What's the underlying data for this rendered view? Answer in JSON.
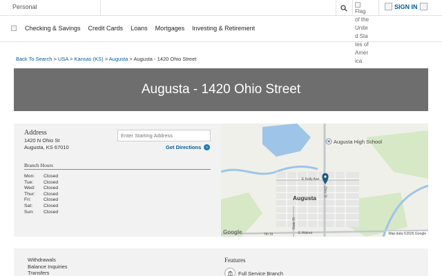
{
  "topbar": {
    "segment": "Personal",
    "flag_alt_text": "Flag of the United States of America",
    "signin_label": "SIGN IN"
  },
  "nav": {
    "items": [
      "Checking & Savings",
      "Credit Cards",
      "Loans",
      "Mortgages",
      "Investing & Retirement"
    ]
  },
  "breadcrumb": {
    "items": [
      "Back To Search",
      "USA",
      "Kansas (KS)",
      "Augusta"
    ],
    "current": "Augusta - 1420 Ohio Street"
  },
  "hero": {
    "title": "Augusta - 1420 Ohio Street"
  },
  "location": {
    "address_heading": "Address",
    "address_line1": "1420 N Ohio St",
    "address_line2": "Augusta, KS 67010",
    "directions_placeholder": "Enter Starting Address",
    "directions_label": "Get Directions",
    "hours_heading": "Branch Hours",
    "hours": [
      {
        "day": "Mon:",
        "value": "Closed"
      },
      {
        "day": "Tue:",
        "value": "Closed"
      },
      {
        "day": "Wed:",
        "value": "Closed"
      },
      {
        "day": "Thur:",
        "value": "Closed"
      },
      {
        "day": "Fri:",
        "value": "Closed"
      },
      {
        "day": "Sat:",
        "value": "Closed"
      },
      {
        "day": "Sun:",
        "value": "Closed"
      }
    ]
  },
  "map": {
    "school_label": "Augusta High School",
    "city_label": "Augusta",
    "road_kelly": "E Kelly Ave",
    "road_ohio": "Ohio St",
    "road_state": "State St",
    "road_7th": "7th St",
    "road_ewalnut": "E Walnut",
    "attribution_logo": "Google",
    "attribution_text": "Map data ©2026 Google",
    "colors": {
      "water": "#9ec4e8",
      "park": "#cfe4bf",
      "pin": "#1b5a7a",
      "road": "#ffffff"
    }
  },
  "services": {
    "items": [
      "Withdrawals",
      "Balance Inquiries",
      "Transfers"
    ]
  },
  "features": {
    "heading": "Features",
    "items": [
      "Full Service Branch"
    ]
  },
  "theme": {
    "link": "#005b9a",
    "hero_bg": "#6e6e6e",
    "panel_bg": "#f2f2f2"
  }
}
